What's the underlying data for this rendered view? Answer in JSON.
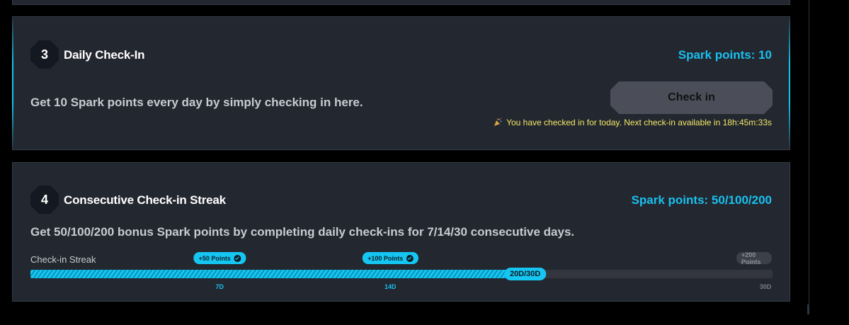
{
  "colors": {
    "accent": "#19c0ef",
    "card_bg": "#23272f",
    "notice": "#f3e86a"
  },
  "tasks": [
    {
      "step": "3",
      "title": "Daily Check-In",
      "points": "Spark points: 10",
      "description": "Get 10 Spark points every day by simply checking in here.",
      "button_label": "Check in",
      "status_icon": "party-popper-icon",
      "status_message": "You have checked in for today. Next check-in available in 18h:45m:33s"
    },
    {
      "step": "4",
      "title": "Consecutive Check-in Streak",
      "points": "Spark points: 50/100/200",
      "description": "Get 50/100/200 bonus Spark points by completing daily check-ins for 7/14/30 consecutive days.",
      "streak": {
        "label": "Check-in Streak",
        "current_days": 20,
        "total_days": 30,
        "progress_label": "20D/30D",
        "milestones": [
          {
            "reward": "+50 Points",
            "day_label": "7D",
            "days": 7,
            "achieved": true
          },
          {
            "reward": "+100 Points",
            "day_label": "14D",
            "days": 14,
            "achieved": true
          },
          {
            "reward": "+200 Points",
            "day_label": "30D",
            "days": 30,
            "achieved": false
          }
        ]
      }
    }
  ]
}
